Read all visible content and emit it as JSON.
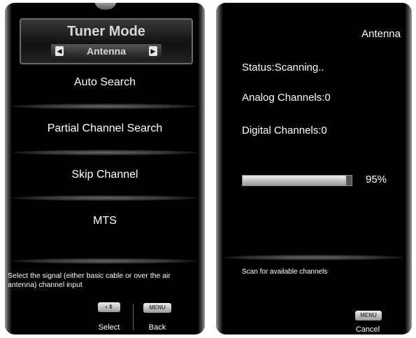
{
  "left_panel": {
    "title": "Tuner Mode",
    "mode_value": "Antenna",
    "menu_items": [
      "Auto Search",
      "Partial Channel Search",
      "Skip Channel",
      "MTS"
    ],
    "help_text": "Select the signal (either basic cable or over the air antenna) channel input",
    "buttons": {
      "select_chip": "◐⬍",
      "select_label": "Select",
      "menu_chip": "MENU",
      "back_label": "Back"
    }
  },
  "right_panel": {
    "source": "Antenna",
    "status": "Status:Scanning..",
    "analog": "Analog Channels:0",
    "digital": "Digital Channels:0",
    "progress_text": "95%",
    "progress_value": 0.95,
    "help_text": "Scan for available channels",
    "menu_chip": "MENU",
    "cancel_label": "Cancel"
  },
  "colors": {
    "panel_bg": "#000000",
    "bezel": "#9a9a9a",
    "text": "#ffffff"
  }
}
